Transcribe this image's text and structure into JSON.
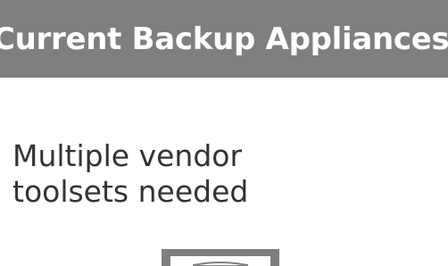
{
  "slide": {
    "title": "Current Backup Appliances",
    "body_line_1": "Multiple vendor",
    "body_line_2": "toolsets needed"
  },
  "colors": {
    "title_bar": "#7f7f7f",
    "title_text": "#ffffff",
    "body_text": "#333333",
    "appliance_frame": "#7f7f7f"
  },
  "icons": {
    "appliance": "backup-appliance-icon"
  }
}
